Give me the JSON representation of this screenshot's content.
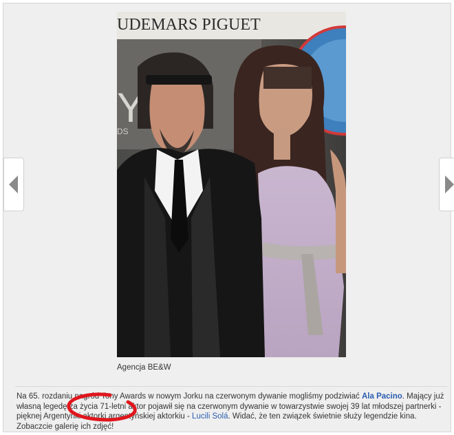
{
  "photo": {
    "banner_text": "UDEMARS PIGUET",
    "backdrop_letters": "Y TO",
    "backdrop_small": "DS"
  },
  "nav": {
    "prev_icon": "chevron-left-icon",
    "next_icon": "chevron-right-icon"
  },
  "caption": "Agencja BE&W",
  "article": {
    "text1": "Na 65. rozdaniu nagród Tony Awards w nowym Jorku na czerwonym dywanie mogliśmy podziwiać ",
    "link1": "Ala Pacino",
    "text2": ". Mający już własną legedę za życia 71-letni aktor pojawił się na czerwonym dywanie w towarzystwie swojej 39 lat młodszej partnerki - pięknej Argentynki aktorki argentyńskiej aktorkiu - ",
    "link2": "Lucili Solá",
    "text3": ". Widać, że ten związek świetnie służy legendzie kina. Zobaczcie galerię ich zdjęć!"
  },
  "colors": {
    "link": "#2a5db0",
    "annotation": "#e0161d",
    "panel": "#efefef"
  }
}
